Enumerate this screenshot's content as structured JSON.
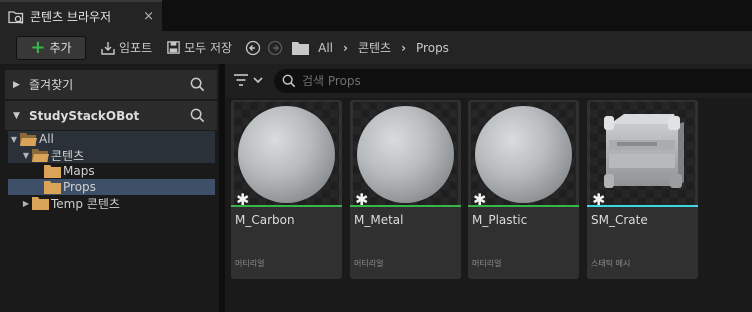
{
  "tab": {
    "title": "콘텐츠 브라우저",
    "close": "×"
  },
  "toolbar": {
    "add_label": "추가",
    "import_label": "임포트",
    "save_all_label": "모두 저장",
    "breadcrumbs": [
      "All",
      "콘텐츠",
      "Props"
    ]
  },
  "left": {
    "favorites_label": "즐겨찾기",
    "project_label": "StudyStackOBot",
    "tree": [
      {
        "label": "All",
        "expanded": true
      },
      {
        "label": "콘텐츠",
        "expanded": true
      },
      {
        "label": "Maps"
      },
      {
        "label": "Props",
        "selected": true
      },
      {
        "label": "Temp 콘텐츠",
        "expanded": false
      }
    ]
  },
  "right": {
    "search_placeholder": "검색 Props",
    "assets": [
      {
        "name": "M_Carbon",
        "type": "머티리얼",
        "type_color": "#39b54a",
        "icon": "sphere"
      },
      {
        "name": "M_Metal",
        "type": "머티리얼",
        "type_color": "#39b54a",
        "icon": "sphere"
      },
      {
        "name": "M_Plastic",
        "type": "머티리얼",
        "type_color": "#39b54a",
        "icon": "sphere"
      },
      {
        "name": "SM_Crate",
        "type": "스태틱 메시",
        "type_color": "#3fd8e0",
        "icon": "crate"
      }
    ]
  },
  "colors": {
    "accent_green": "#39b54a",
    "mesh_cyan": "#3fd8e0",
    "selection": "#3e5068"
  }
}
